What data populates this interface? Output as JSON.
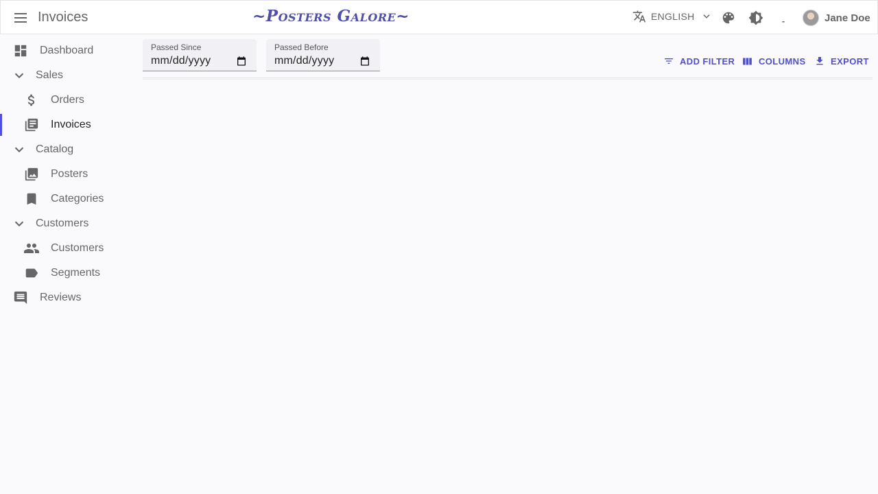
{
  "appbar": {
    "title": "Invoices",
    "brand": "~Posters Galore~",
    "language": "ENGLISH",
    "loading_indicator": "-",
    "user_name": "Jane Doe"
  },
  "sidebar": {
    "items": [
      {
        "label": "Dashboard",
        "icon": "dashboard-icon"
      },
      {
        "label": "Sales",
        "icon": "chevron-down-icon"
      },
      {
        "label": "Orders",
        "icon": "dollar-icon"
      },
      {
        "label": "Invoices",
        "icon": "invoice-icon",
        "active": true
      },
      {
        "label": "Catalog",
        "icon": "chevron-down-icon"
      },
      {
        "label": "Posters",
        "icon": "image-collection-icon"
      },
      {
        "label": "Categories",
        "icon": "bookmark-icon"
      },
      {
        "label": "Customers",
        "icon": "chevron-down-icon"
      },
      {
        "label": "Customers",
        "icon": "people-icon"
      },
      {
        "label": "Segments",
        "icon": "label-icon"
      },
      {
        "label": "Reviews",
        "icon": "comment-icon"
      }
    ]
  },
  "filters": {
    "passed_since": {
      "label": "Passed Since",
      "value": "mm/dd/yyyy"
    },
    "passed_before": {
      "label": "Passed Before",
      "value": "mm/dd/yyyy"
    }
  },
  "toolbar": {
    "add_filter": "ADD FILTER",
    "columns": "COLUMNS",
    "export": "EXPORT"
  },
  "colors": {
    "accent": "#4f4fcc",
    "brand": "#4f4fa8",
    "active_indicator": "#4f4fe0"
  }
}
